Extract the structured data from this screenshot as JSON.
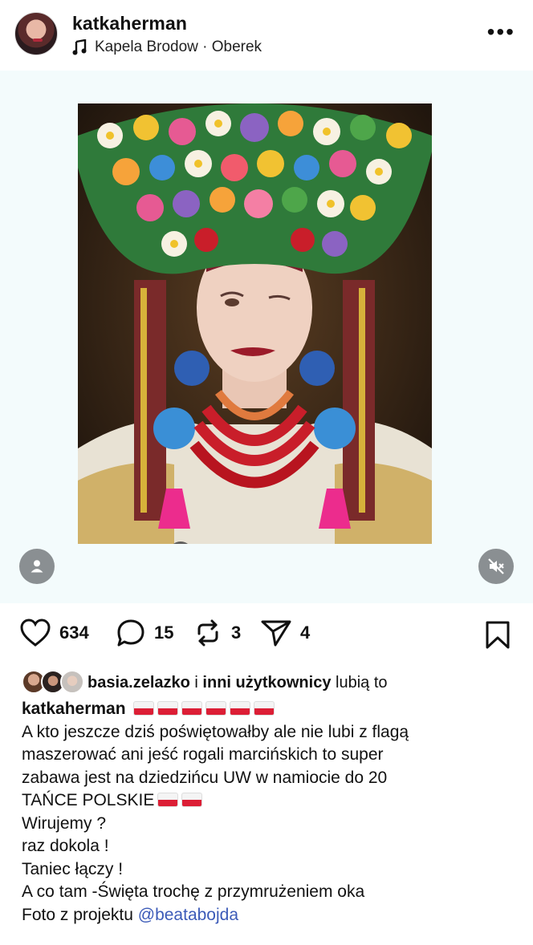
{
  "header": {
    "username": "katkaherman",
    "audio": "Kapela Brodow · Oberek",
    "more_label": "•••"
  },
  "media": {
    "image_alt": "Woman wearing floral folk headdress with red and coral bead necklaces",
    "tag_icon": "person-icon",
    "mute_icon": "speaker-muted-icon"
  },
  "actions": {
    "likes_count": "634",
    "comments_count": "15",
    "reposts_count": "3",
    "shares_count": "4"
  },
  "liked_by": {
    "user": "basia.zelazko",
    "connector": "i",
    "others": "inni użytkownicy",
    "suffix": "lubią to"
  },
  "caption": {
    "username": "katkaherman",
    "lines": [
      "A kto jeszcze dziś poświętowałby ale nie lubi z flagą",
      "maszerować ani jeść rogali marcińskich to super",
      "zabawa jest  na dziedzińcu UW w namiocie do 20",
      "TAŃCE POLSKIE",
      "Wirujemy ?",
      "raz dokola !",
      "Taniec łączy !",
      "A co tam -Święta trochę z przymrużeniem oka",
      "Foto  z projektu"
    ],
    "mention": "@beatabojda"
  },
  "colors": {
    "media_bg": "#f3fbfc",
    "mention": "#3c5bb8",
    "flag_red": "#dc1e35"
  }
}
